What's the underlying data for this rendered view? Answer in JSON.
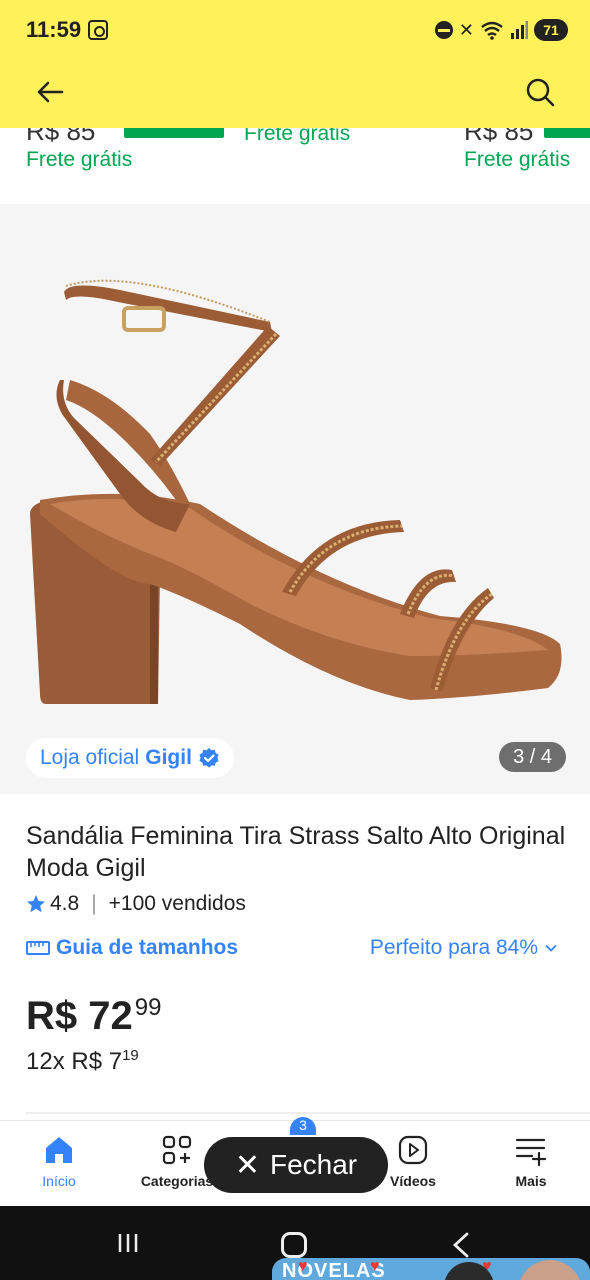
{
  "status_bar": {
    "time": "11:59",
    "battery": "71"
  },
  "carousel_strip": {
    "left_frete": "Frete grátis",
    "middle_frete": "Frete grátis",
    "right_frete": "Frete grátis",
    "left_price_cut": "R$ 85",
    "right_price_cut": "R$ 85"
  },
  "gallery": {
    "image_alt": "sandália marrom salto bloco com tiras de strass",
    "store_prefix": "Loja oficial",
    "store_name": "Gigil",
    "counter": "3 / 4"
  },
  "product": {
    "title": "Sandália Feminina Tira Strass Salto Alto Original Moda Gigil",
    "rating": "4.8",
    "sold": "+100 vendidos",
    "size_guide": "Guia de tamanhos",
    "fit": "Perfeito para 84%",
    "price_main": "R$ 72",
    "price_cents": "99",
    "installments_prefix": "12x",
    "installments_main": "R$ 7",
    "installments_cents": "19"
  },
  "bottom_nav": {
    "items": [
      {
        "label": "Início",
        "icon": "home-icon"
      },
      {
        "label": "Categorias",
        "icon": "categories-icon"
      },
      {
        "label": "Vídeos",
        "icon": "video-icon"
      },
      {
        "label": "Mais",
        "icon": "more-icon"
      }
    ],
    "badge": "3",
    "close_label": "Fechar"
  },
  "pip_banner": {
    "text": "NOVELAS"
  },
  "colors": {
    "header_yellow": "#fff159",
    "accent_blue": "#3483fa",
    "free_shipping_green": "#00a650"
  }
}
